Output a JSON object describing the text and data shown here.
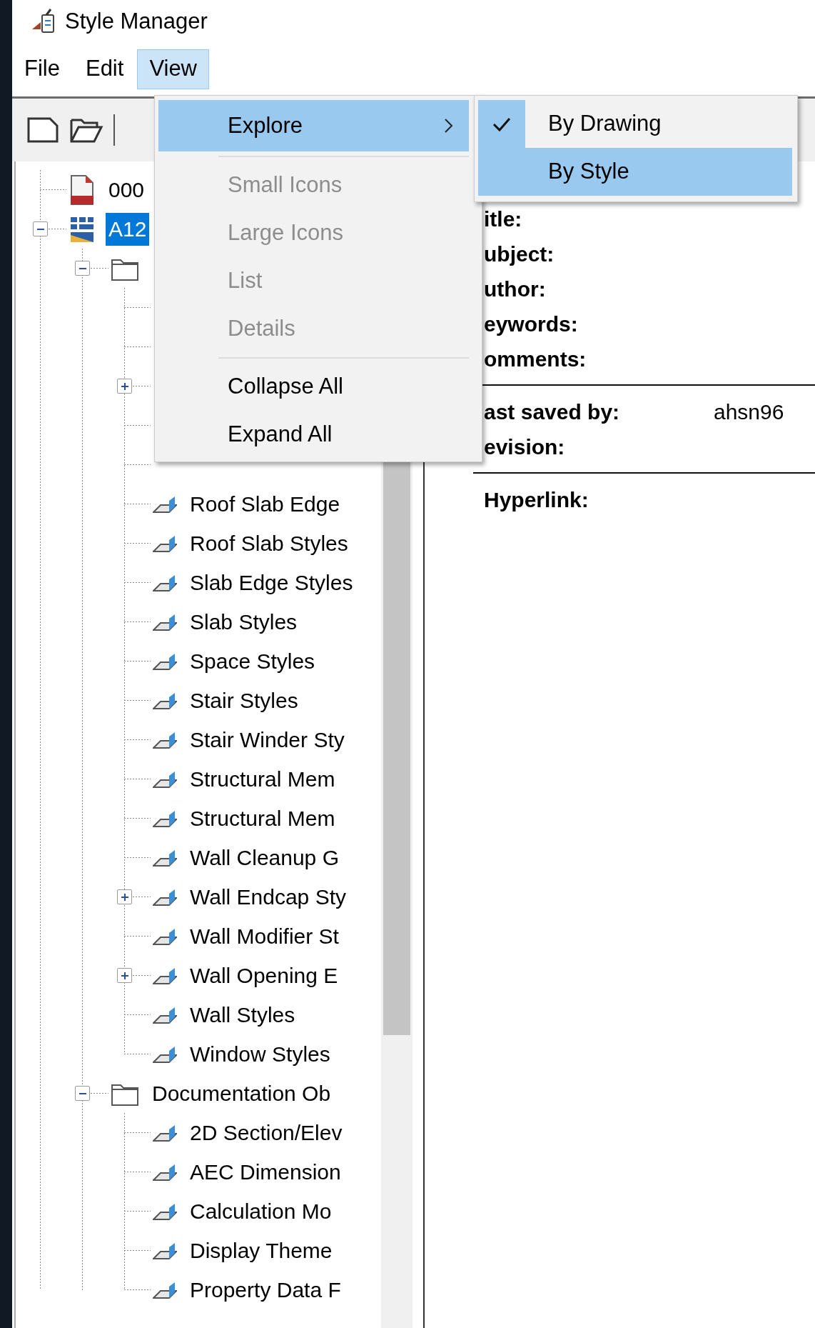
{
  "window": {
    "title": "Style Manager"
  },
  "menu_bar": [
    {
      "label": "File",
      "selected": false
    },
    {
      "label": "Edit",
      "selected": false
    },
    {
      "label": "View",
      "selected": true
    }
  ],
  "tree": [
    {
      "kind": "dwg-file",
      "label": "000",
      "selected": false
    },
    {
      "kind": "drawing",
      "label": "A12",
      "selected": true,
      "expanded": true,
      "children": [
        {
          "kind": "folder",
          "expanded": true,
          "children": [
            {
              "kind": "style"
            },
            {
              "kind": "style"
            },
            {
              "kind": "style",
              "expanded": false
            },
            {
              "kind": "style"
            },
            {
              "kind": "style"
            },
            {
              "kind": "style",
              "label": "Roof Slab Edge",
              "selected": false
            },
            {
              "kind": "style",
              "label": "Roof Slab Styles",
              "selected": false
            },
            {
              "kind": "style",
              "label": "Slab Edge Styles",
              "selected": false
            },
            {
              "kind": "style",
              "label": "Slab Styles",
              "selected": false
            },
            {
              "kind": "style",
              "label": "Space Styles",
              "selected": false
            },
            {
              "kind": "style",
              "label": "Stair Styles",
              "selected": false
            },
            {
              "kind": "style",
              "label": "Stair Winder Sty",
              "selected": false
            },
            {
              "kind": "style",
              "label": "Structural Mem",
              "selected": false
            },
            {
              "kind": "style",
              "label": "Structural Mem",
              "selected": false
            },
            {
              "kind": "style",
              "label": "Wall Cleanup G",
              "selected": false
            },
            {
              "kind": "style",
              "label": "Wall Endcap Sty",
              "selected": false,
              "expanded": false
            },
            {
              "kind": "style",
              "label": "Wall Modifier St",
              "selected": false
            },
            {
              "kind": "style",
              "label": "Wall Opening E",
              "selected": false,
              "expanded": false
            },
            {
              "kind": "style",
              "label": "Wall Styles",
              "selected": false
            },
            {
              "kind": "style",
              "label": "Window Styles",
              "selected": false
            }
          ]
        },
        {
          "kind": "folder",
          "label": "Documentation Ob",
          "selected": false,
          "expanded": true,
          "children": [
            {
              "kind": "style",
              "label": "2D Section/Elev",
              "selected": false
            },
            {
              "kind": "style",
              "label": "AEC Dimension",
              "selected": false
            },
            {
              "kind": "style",
              "label": "Calculation Mo",
              "selected": false
            },
            {
              "kind": "style",
              "label": "Display Theme",
              "selected": false
            },
            {
              "kind": "style",
              "label": "Property Data F",
              "selected": false
            }
          ]
        }
      ]
    }
  ],
  "info": {
    "sections": [
      [
        {
          "label": "itle:"
        },
        {
          "label": "ubject:"
        },
        {
          "label": "uthor:"
        },
        {
          "label": "eywords:"
        },
        {
          "label": "omments:"
        }
      ],
      [
        {
          "label": "ast saved by:",
          "value": "ahsn96"
        },
        {
          "label": "evision:"
        }
      ],
      [
        {
          "label": "Hyperlink:"
        }
      ]
    ]
  },
  "view_menu": {
    "items": [
      {
        "kind": "submenu",
        "label": "Explore",
        "selected": true,
        "disabled": false
      },
      {
        "kind": "separator"
      },
      {
        "kind": "item",
        "label": "Small Icons",
        "selected": false,
        "disabled": true
      },
      {
        "kind": "item",
        "label": "Large Icons",
        "selected": false,
        "disabled": true
      },
      {
        "kind": "item",
        "label": "List",
        "selected": false,
        "disabled": true
      },
      {
        "kind": "item",
        "label": "Details",
        "selected": false,
        "disabled": true
      },
      {
        "kind": "separator"
      },
      {
        "kind": "item",
        "label": "Collapse All",
        "selected": false,
        "disabled": false
      },
      {
        "kind": "item",
        "label": "Expand All",
        "selected": false,
        "disabled": false
      }
    ]
  },
  "explore_submenu": {
    "items": [
      {
        "label": "By Drawing",
        "checked": true,
        "selected": false
      },
      {
        "label": "By Style",
        "checked": false,
        "selected": true
      }
    ]
  }
}
